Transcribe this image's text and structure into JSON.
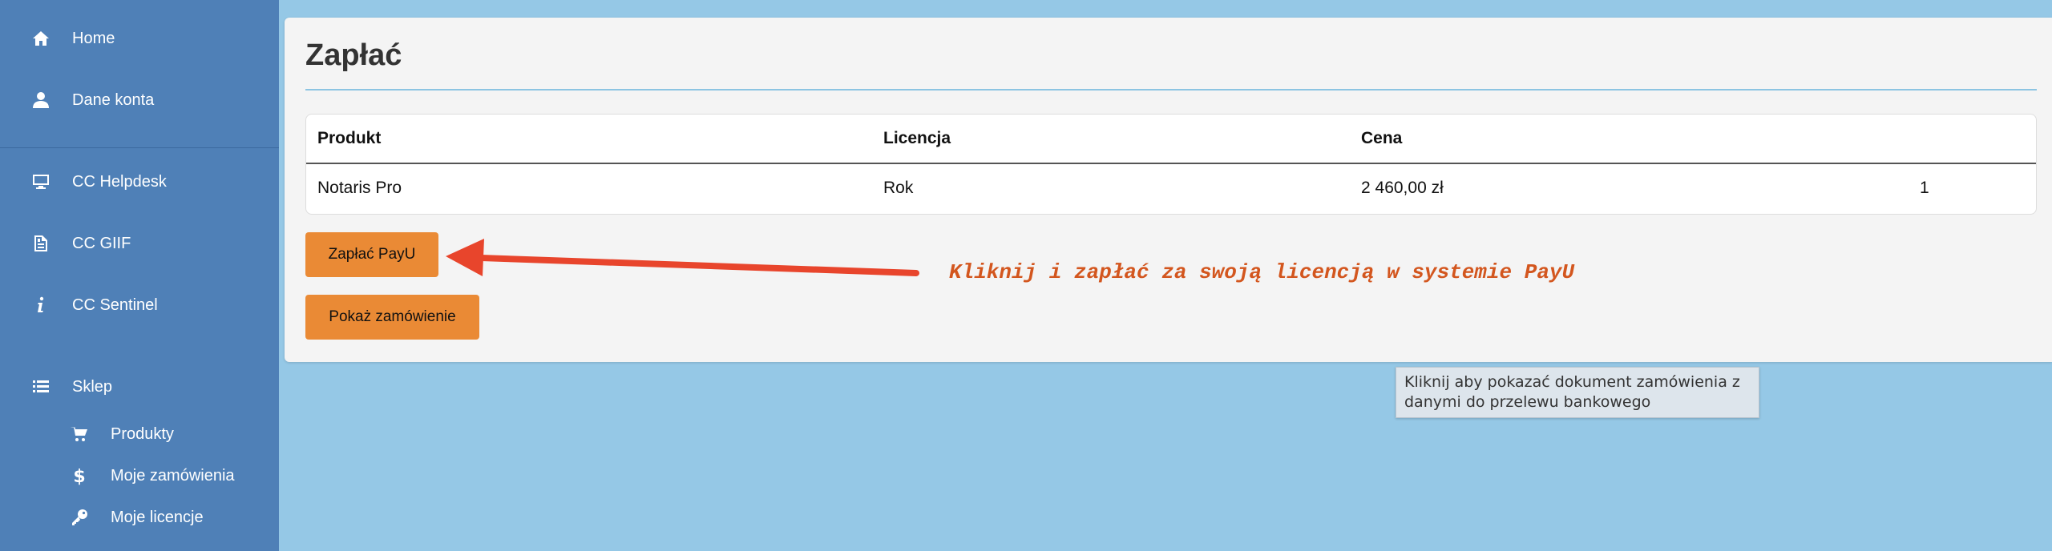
{
  "sidebar": {
    "items": [
      {
        "label": "Home",
        "icon": "home-icon"
      },
      {
        "label": "Dane konta",
        "icon": "user-icon"
      },
      {
        "label": "CC Helpdesk",
        "icon": "monitor-icon"
      },
      {
        "label": "CC GIIF",
        "icon": "document-icon"
      },
      {
        "label": "CC Sentinel",
        "icon": "info-icon"
      },
      {
        "label": "Sklep",
        "icon": "list-icon"
      }
    ],
    "subitems": [
      {
        "label": "Produkty",
        "icon": "cart-icon"
      },
      {
        "label": "Moje zamówienia",
        "icon": "dollar-icon"
      },
      {
        "label": "Moje licencje",
        "icon": "key-icon"
      }
    ]
  },
  "main": {
    "title": "Zapłać",
    "table": {
      "headers": [
        "Produkt",
        "Licencja",
        "Cena",
        ""
      ],
      "rows": [
        [
          "Notaris Pro",
          "Rok",
          "2 460,00 zł",
          "1"
        ]
      ]
    },
    "buttons": {
      "pay": "Zapłać PayU",
      "show_order": "Pokaż zamówienie"
    },
    "annotation": "Kliknij i zapłać za swoją licencją w systemie PayU",
    "tooltip": "Kliknij aby pokazać dokument zamówienia z danymi do przelewu bankowego"
  },
  "colors": {
    "sidebar_bg": "#4f80b7",
    "page_bg": "#95c8e6",
    "button": "#ea8a35",
    "annotation": "#d3561e",
    "arrow": "#e8452c"
  }
}
